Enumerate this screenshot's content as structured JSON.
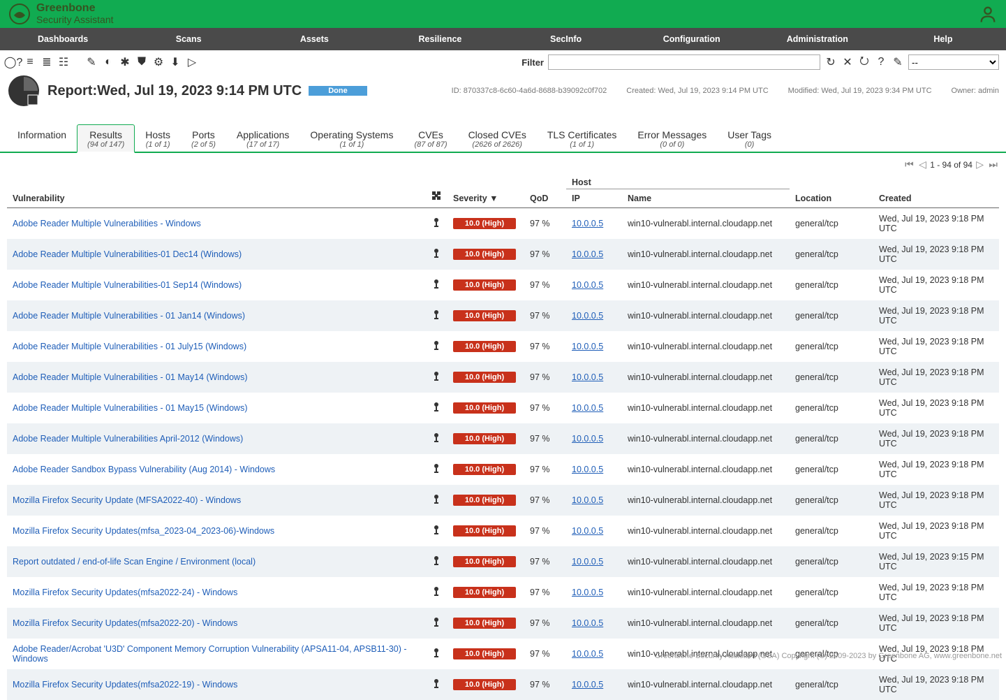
{
  "brand": {
    "line1": "Greenbone",
    "line2": "Security Assistant"
  },
  "nav": [
    "Dashboards",
    "Scans",
    "Assets",
    "Resilience",
    "SecInfo",
    "Configuration",
    "Administration",
    "Help"
  ],
  "filter": {
    "label": "Filter",
    "value": "",
    "select": "--"
  },
  "report": {
    "title": "Report:Wed, Jul 19, 2023 9:14 PM UTC",
    "status": "Done",
    "id_label": "ID: 870337c8-6c60-4a6d-8688-b39092c0f702",
    "created": "Created: Wed, Jul 19, 2023 9:14 PM UTC",
    "modified": "Modified: Wed, Jul 19, 2023 9:34 PM UTC",
    "owner": "Owner: admin"
  },
  "tabs": [
    {
      "label": "Information",
      "count": ""
    },
    {
      "label": "Results",
      "count": "(94 of 147)"
    },
    {
      "label": "Hosts",
      "count": "(1 of 1)"
    },
    {
      "label": "Ports",
      "count": "(2 of 5)"
    },
    {
      "label": "Applications",
      "count": "(17 of 17)"
    },
    {
      "label": "Operating Systems",
      "count": "(1 of 1)"
    },
    {
      "label": "CVEs",
      "count": "(87 of 87)"
    },
    {
      "label": "Closed CVEs",
      "count": "(2626 of 2626)"
    },
    {
      "label": "TLS Certificates",
      "count": "(1 of 1)"
    },
    {
      "label": "Error Messages",
      "count": "(0 of 0)"
    },
    {
      "label": "User Tags",
      "count": "(0)"
    }
  ],
  "pager": "1 - 94 of 94",
  "columns": {
    "vuln": "Vulnerability",
    "severity": "Severity ▼",
    "qod": "QoD",
    "host": "Host",
    "ip": "IP",
    "name": "Name",
    "location": "Location",
    "created": "Created"
  },
  "rows": [
    {
      "vuln": "Adobe Reader Multiple Vulnerabilities - Windows",
      "sev": "10.0 (High)",
      "qod": "97 %",
      "ip": "10.0.0.5",
      "host": "win10-vulnerabl.internal.cloudapp.net",
      "loc": "general/tcp",
      "created": "Wed, Jul 19, 2023 9:18 PM UTC"
    },
    {
      "vuln": "Adobe Reader Multiple Vulnerabilities-01 Dec14 (Windows)",
      "sev": "10.0 (High)",
      "qod": "97 %",
      "ip": "10.0.0.5",
      "host": "win10-vulnerabl.internal.cloudapp.net",
      "loc": "general/tcp",
      "created": "Wed, Jul 19, 2023 9:18 PM UTC"
    },
    {
      "vuln": "Adobe Reader Multiple Vulnerabilities-01 Sep14 (Windows)",
      "sev": "10.0 (High)",
      "qod": "97 %",
      "ip": "10.0.0.5",
      "host": "win10-vulnerabl.internal.cloudapp.net",
      "loc": "general/tcp",
      "created": "Wed, Jul 19, 2023 9:18 PM UTC"
    },
    {
      "vuln": "Adobe Reader Multiple Vulnerabilities - 01 Jan14 (Windows)",
      "sev": "10.0 (High)",
      "qod": "97 %",
      "ip": "10.0.0.5",
      "host": "win10-vulnerabl.internal.cloudapp.net",
      "loc": "general/tcp",
      "created": "Wed, Jul 19, 2023 9:18 PM UTC"
    },
    {
      "vuln": "Adobe Reader Multiple Vulnerabilities - 01 July15 (Windows)",
      "sev": "10.0 (High)",
      "qod": "97 %",
      "ip": "10.0.0.5",
      "host": "win10-vulnerabl.internal.cloudapp.net",
      "loc": "general/tcp",
      "created": "Wed, Jul 19, 2023 9:18 PM UTC"
    },
    {
      "vuln": "Adobe Reader Multiple Vulnerabilities - 01 May14 (Windows)",
      "sev": "10.0 (High)",
      "qod": "97 %",
      "ip": "10.0.0.5",
      "host": "win10-vulnerabl.internal.cloudapp.net",
      "loc": "general/tcp",
      "created": "Wed, Jul 19, 2023 9:18 PM UTC"
    },
    {
      "vuln": "Adobe Reader Multiple Vulnerabilities - 01 May15 (Windows)",
      "sev": "10.0 (High)",
      "qod": "97 %",
      "ip": "10.0.0.5",
      "host": "win10-vulnerabl.internal.cloudapp.net",
      "loc": "general/tcp",
      "created": "Wed, Jul 19, 2023 9:18 PM UTC"
    },
    {
      "vuln": "Adobe Reader Multiple Vulnerabilities April-2012 (Windows)",
      "sev": "10.0 (High)",
      "qod": "97 %",
      "ip": "10.0.0.5",
      "host": "win10-vulnerabl.internal.cloudapp.net",
      "loc": "general/tcp",
      "created": "Wed, Jul 19, 2023 9:18 PM UTC"
    },
    {
      "vuln": "Adobe Reader Sandbox Bypass Vulnerability (Aug 2014) - Windows",
      "sev": "10.0 (High)",
      "qod": "97 %",
      "ip": "10.0.0.5",
      "host": "win10-vulnerabl.internal.cloudapp.net",
      "loc": "general/tcp",
      "created": "Wed, Jul 19, 2023 9:18 PM UTC"
    },
    {
      "vuln": "Mozilla Firefox Security Update (MFSA2022-40) - Windows",
      "sev": "10.0 (High)",
      "qod": "97 %",
      "ip": "10.0.0.5",
      "host": "win10-vulnerabl.internal.cloudapp.net",
      "loc": "general/tcp",
      "created": "Wed, Jul 19, 2023 9:18 PM UTC"
    },
    {
      "vuln": "Mozilla Firefox Security Updates(mfsa_2023-04_2023-06)-Windows",
      "sev": "10.0 (High)",
      "qod": "97 %",
      "ip": "10.0.0.5",
      "host": "win10-vulnerabl.internal.cloudapp.net",
      "loc": "general/tcp",
      "created": "Wed, Jul 19, 2023 9:18 PM UTC"
    },
    {
      "vuln": "Report outdated / end-of-life Scan Engine / Environment (local)",
      "sev": "10.0 (High)",
      "qod": "97 %",
      "ip": "10.0.0.5",
      "host": "win10-vulnerabl.internal.cloudapp.net",
      "loc": "general/tcp",
      "created": "Wed, Jul 19, 2023 9:15 PM UTC"
    },
    {
      "vuln": "Mozilla Firefox Security Updates(mfsa2022-24) - Windows",
      "sev": "10.0 (High)",
      "qod": "97 %",
      "ip": "10.0.0.5",
      "host": "win10-vulnerabl.internal.cloudapp.net",
      "loc": "general/tcp",
      "created": "Wed, Jul 19, 2023 9:18 PM UTC"
    },
    {
      "vuln": "Mozilla Firefox Security Updates(mfsa2022-20) - Windows",
      "sev": "10.0 (High)",
      "qod": "97 %",
      "ip": "10.0.0.5",
      "host": "win10-vulnerabl.internal.cloudapp.net",
      "loc": "general/tcp",
      "created": "Wed, Jul 19, 2023 9:18 PM UTC"
    },
    {
      "vuln": "Adobe Reader/Acrobat 'U3D' Component Memory Corruption Vulnerability (APSA11-04, APSB11-30) - Windows",
      "sev": "10.0 (High)",
      "qod": "97 %",
      "ip": "10.0.0.5",
      "host": "win10-vulnerabl.internal.cloudapp.net",
      "loc": "general/tcp",
      "created": "Wed, Jul 19, 2023 9:18 PM UTC"
    },
    {
      "vuln": "Mozilla Firefox Security Updates(mfsa2022-19) - Windows",
      "sev": "10.0 (High)",
      "qod": "97 %",
      "ip": "10.0.0.5",
      "host": "win10-vulnerabl.internal.cloudapp.net",
      "loc": "general/tcp",
      "created": "Wed, Jul 19, 2023 9:18 PM UTC"
    }
  ],
  "footer": "Greenbone Security Assistant (GSA) Copyright (C) 2009-2023 by Greenbone AG, www.greenbone.net"
}
